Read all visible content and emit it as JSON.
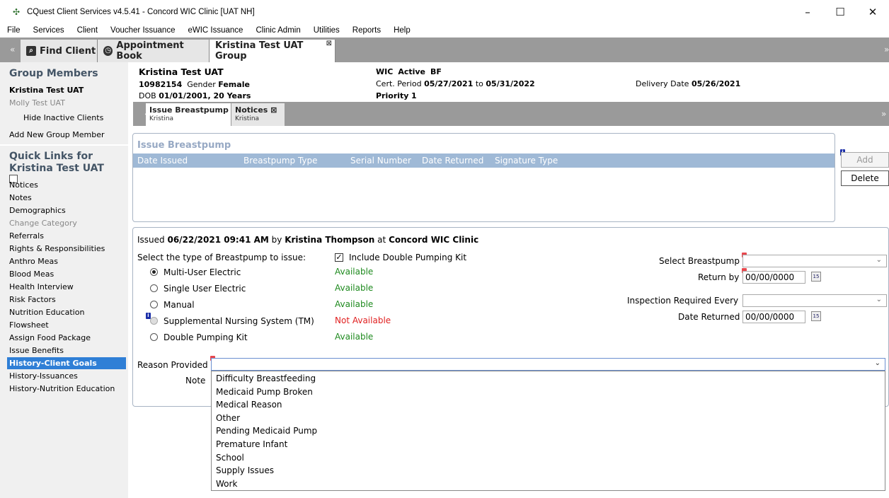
{
  "window": {
    "title": "CQuest Client Services v4.5.41  - Concord WIC Clinic [UAT NH]",
    "minimize": "–",
    "maximize": "☐",
    "close": "✕"
  },
  "menu": [
    "File",
    "Services",
    "Client",
    "Voucher Issuance",
    "eWIC Issuance",
    "Clinic Admin",
    "Utilities",
    "Reports",
    "Help"
  ],
  "main_tabs": {
    "find_client": "Find Client",
    "appointment_book": "Appointment Book",
    "group": "Kristina Test UAT Group",
    "left_arrow": "«",
    "right_arrow": "»"
  },
  "sidebar": {
    "group_heading": "Group Members",
    "members": [
      "Kristina Test UAT",
      "Molly Test UAT"
    ],
    "hide_inactive": "Hide Inactive Clients",
    "add_member": "Add New Group Member",
    "quick_links_heading_1": "Quick Links for",
    "quick_links_heading_2": "Kristina Test UAT",
    "links": [
      "Notices",
      "Notes",
      "Demographics",
      "Change Category",
      "Referrals",
      "Rights & Responsibilities",
      "Anthro Meas",
      "Blood Meas",
      "Health Interview",
      "Risk Factors",
      "Nutrition Education",
      "Flowsheet",
      "Assign Food Package",
      "Issue Benefits",
      "History-Client Goals",
      "History-Issuances",
      "History-Nutrition Education"
    ],
    "selected_link": "History-Client Goals"
  },
  "client": {
    "name": "Kristina Test UAT",
    "id": "10982154",
    "gender_label": "Gender",
    "gender": "Female",
    "dob_label": "DOB",
    "dob": "01/01/2001, 20 Years",
    "wic_status_label": "WIC",
    "wic_status": "Active",
    "category": "BF",
    "cert_label": "Cert. Period",
    "cert_start": "05/27/2021",
    "cert_to": "to",
    "cert_end": "05/31/2022",
    "priority_label": "Priority",
    "priority": "1",
    "delivery_label": "Delivery Date",
    "delivery_date": "05/26/2021"
  },
  "sub_tabs": [
    {
      "label": "Issue Breastpump",
      "sub": "Kristina"
    },
    {
      "label": "Notices",
      "sub": "Kristina"
    }
  ],
  "breastpump_list": {
    "title": "Issue Breastpump",
    "columns": [
      "Date Issued",
      "Breastpump Type",
      "Serial Number",
      "Date Returned",
      "Signature Type"
    ],
    "add_button": "Add",
    "delete_button": "Delete"
  },
  "issue_form": {
    "issued_label": "Issued",
    "issued_datetime": "06/22/2021 09:41 AM",
    "by_label": "by",
    "issued_by": "Kristina Thompson",
    "at_label": "at",
    "clinic": "Concord WIC Clinic",
    "select_type_label": "Select the type of Breastpump to issue:",
    "include_kit_label": "Include Double Pumping Kit",
    "types": [
      {
        "label": "Multi-User Electric",
        "status": "Available"
      },
      {
        "label": "Single User Electric",
        "status": "Available"
      },
      {
        "label": "Manual",
        "status": "Available"
      },
      {
        "label": "Supplemental Nursing System (TM)",
        "status": "Not Available"
      },
      {
        "label": "Double Pumping Kit",
        "status": "Available"
      }
    ],
    "select_breastpump_label": "Select Breastpump",
    "return_by_label": "Return by",
    "return_by_value": "00/00/0000",
    "inspection_label": "Inspection Required Every",
    "date_returned_label": "Date Returned",
    "date_returned_value": "00/00/0000",
    "reason_label": "Reason Provided",
    "note_label": "Note",
    "calendar_icon_text": "15",
    "chevron": "⌄"
  },
  "reason_options": [
    "Difficulty Breastfeeding",
    "Medicaid Pump Broken",
    "Medical Reason",
    "Other",
    "Pending Medicaid Pump",
    "Premature Infant",
    "School",
    "Supply Issues",
    "Work"
  ]
}
